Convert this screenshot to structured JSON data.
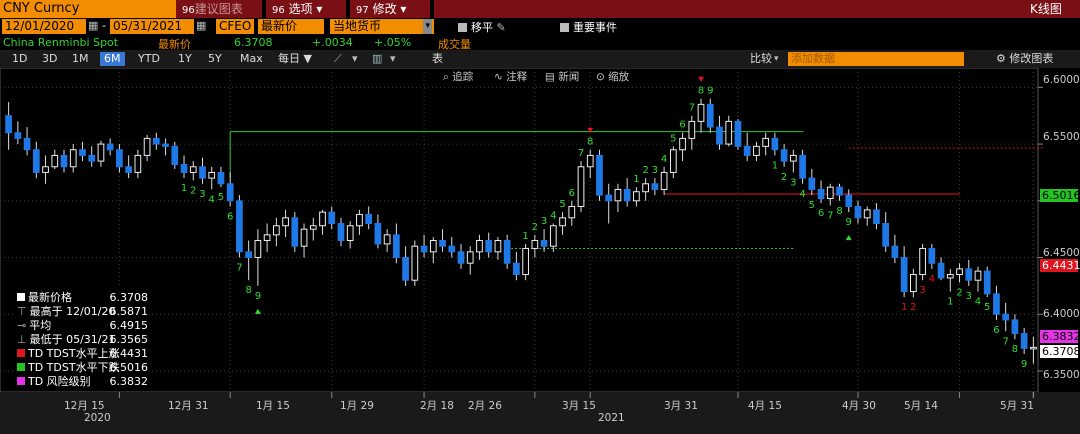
{
  "header": {
    "ticker": "CNY Curncy",
    "menus": [
      {
        "num": "96",
        "label": "建议图表"
      },
      {
        "num": "96",
        "label": "选项"
      },
      {
        "num": "97",
        "label": "修改"
      }
    ],
    "view_title": "K线图"
  },
  "controls": {
    "date_start": "12/01/2020",
    "date_end": "05/31/2021",
    "source": "CFEO",
    "field": "最新价",
    "currency": "当地货币",
    "move_label": "移平",
    "events_label": "重要事件"
  },
  "quote": {
    "name": "China Renminbi Spot",
    "last_label": "最新价",
    "last": "6.3708",
    "change": "+.0034",
    "pct": "+.05%",
    "volume_label": "成交量"
  },
  "toolbar": {
    "periods": [
      "1D",
      "3D",
      "1M",
      "6M",
      "YTD",
      "1Y",
      "5Y",
      "Max"
    ],
    "selected_period": "6M",
    "frequency": "每日",
    "table_label": "表",
    "compare_label": "比较",
    "compare_placeholder": "添加数据",
    "edit_label": "修改图表"
  },
  "chart_tools": {
    "track": "追踪",
    "annotate": "注释",
    "news": "新闻",
    "zoom": "缩放"
  },
  "legend": [
    {
      "label": "最新价格",
      "value": "6.3708",
      "color": "#ffffff"
    },
    {
      "label": "最高于 12/01/20",
      "value": "6.5871",
      "color": "none"
    },
    {
      "label": "平均",
      "value": "6.4915",
      "color": "none"
    },
    {
      "label": "最低于 05/31/21",
      "value": "6.3565",
      "color": "none"
    },
    {
      "label": "TD TDST水平上涨",
      "value": "6.4431",
      "color": "#e0141e"
    },
    {
      "label": "TD TDST水平下跌",
      "value": "6.5016",
      "color": "#22c322"
    },
    {
      "label": "TD 风险级别",
      "value": "6.3832",
      "color": "#e632e6"
    }
  ],
  "price_tags": [
    {
      "value": "6.5016",
      "bg": "#22c322",
      "fg": "#000000"
    },
    {
      "value": "6.4431",
      "bg": "#e0141e",
      "fg": "#ffffff"
    },
    {
      "value": "6.3832",
      "bg": "#e632e6",
      "fg": "#000000"
    },
    {
      "value": "6.3708",
      "bg": "#ffffff",
      "fg": "#000000"
    }
  ],
  "chart_data": {
    "type": "candlestick",
    "ylim": [
      6.335,
      6.61
    ],
    "yticks": [
      "6.6000",
      "6.5500",
      "6.5000",
      "6.4500",
      "6.4000",
      "6.3500"
    ],
    "xticks": [
      "12月 15",
      "12月 31",
      "1月 15",
      "1月 29",
      "2月 18",
      "2月 26",
      "3月 15",
      "3月 31",
      "4月 15",
      "4月 30",
      "5月 14",
      "5月 31"
    ],
    "year_labels": [
      "2020",
      "2021"
    ],
    "colors": {
      "up": "#ffffff",
      "down": "#1e78e6",
      "td_setup": "#32dc32",
      "td_countdown": "#e0141e"
    },
    "candles": [
      [
        6.575,
        6.587,
        6.545,
        6.56
      ],
      [
        6.56,
        6.57,
        6.55,
        6.555
      ],
      [
        6.555,
        6.565,
        6.54,
        6.545
      ],
      [
        6.545,
        6.552,
        6.52,
        6.525
      ],
      [
        6.525,
        6.54,
        6.515,
        6.53
      ],
      [
        6.53,
        6.545,
        6.528,
        6.54
      ],
      [
        6.54,
        6.545,
        6.525,
        6.53
      ],
      [
        6.53,
        6.55,
        6.525,
        6.545
      ],
      [
        6.545,
        6.552,
        6.535,
        6.54
      ],
      [
        6.54,
        6.548,
        6.53,
        6.535
      ],
      [
        6.535,
        6.553,
        6.53,
        6.55
      ],
      [
        6.55,
        6.555,
        6.54,
        6.545
      ],
      [
        6.545,
        6.55,
        6.525,
        6.53
      ],
      [
        6.53,
        6.54,
        6.52,
        6.525
      ],
      [
        6.525,
        6.545,
        6.52,
        6.54
      ],
      [
        6.54,
        6.558,
        6.535,
        6.555
      ],
      [
        6.555,
        6.56,
        6.545,
        6.55
      ],
      [
        6.55,
        6.555,
        6.54,
        6.548
      ],
      [
        6.548,
        6.552,
        6.528,
        6.532
      ],
      [
        6.532,
        6.54,
        6.52,
        6.525
      ],
      [
        6.525,
        6.535,
        6.518,
        6.53
      ],
      [
        6.53,
        6.538,
        6.515,
        6.52
      ],
      [
        6.52,
        6.53,
        6.51,
        6.525
      ],
      [
        6.525,
        6.53,
        6.512,
        6.515
      ],
      [
        6.515,
        6.525,
        6.495,
        6.5
      ],
      [
        6.5,
        6.505,
        6.45,
        6.455
      ],
      [
        6.455,
        6.465,
        6.43,
        6.45
      ],
      [
        6.45,
        6.475,
        6.425,
        6.465
      ],
      [
        6.465,
        6.48,
        6.455,
        6.47
      ],
      [
        6.47,
        6.485,
        6.46,
        6.478
      ],
      [
        6.478,
        6.492,
        6.468,
        6.485
      ],
      [
        6.485,
        6.49,
        6.455,
        6.46
      ],
      [
        6.46,
        6.48,
        6.45,
        6.475
      ],
      [
        6.475,
        6.485,
        6.465,
        6.478
      ],
      [
        6.478,
        6.492,
        6.47,
        6.49
      ],
      [
        6.49,
        6.495,
        6.475,
        6.48
      ],
      [
        6.48,
        6.485,
        6.46,
        6.465
      ],
      [
        6.465,
        6.482,
        6.458,
        6.478
      ],
      [
        6.478,
        6.492,
        6.47,
        6.488
      ],
      [
        6.488,
        6.495,
        6.475,
        6.48
      ],
      [
        6.48,
        6.488,
        6.458,
        6.462
      ],
      [
        6.462,
        6.475,
        6.455,
        6.47
      ],
      [
        6.47,
        6.48,
        6.445,
        6.45
      ],
      [
        6.45,
        6.46,
        6.425,
        6.43
      ],
      [
        6.43,
        6.465,
        6.425,
        6.46
      ],
      [
        6.46,
        6.47,
        6.45,
        6.455
      ],
      [
        6.455,
        6.468,
        6.445,
        6.465
      ],
      [
        6.465,
        6.475,
        6.455,
        6.46
      ],
      [
        6.46,
        6.468,
        6.45,
        6.455
      ],
      [
        6.455,
        6.462,
        6.44,
        6.445
      ],
      [
        6.445,
        6.46,
        6.435,
        6.455
      ],
      [
        6.455,
        6.47,
        6.448,
        6.465
      ],
      [
        6.465,
        6.472,
        6.45,
        6.455
      ],
      [
        6.455,
        6.468,
        6.448,
        6.465
      ],
      [
        6.465,
        6.47,
        6.44,
        6.445
      ],
      [
        6.445,
        6.455,
        6.43,
        6.435
      ],
      [
        6.435,
        6.462,
        6.43,
        6.458
      ],
      [
        6.458,
        6.47,
        6.45,
        6.465
      ],
      [
        6.465,
        6.475,
        6.455,
        6.46
      ],
      [
        6.46,
        6.48,
        6.455,
        6.478
      ],
      [
        6.478,
        6.49,
        6.47,
        6.485
      ],
      [
        6.485,
        6.5,
        6.478,
        6.495
      ],
      [
        6.495,
        6.535,
        6.49,
        6.53
      ],
      [
        6.53,
        6.545,
        6.52,
        6.54
      ],
      [
        6.54,
        6.545,
        6.5,
        6.505
      ],
      [
        6.505,
        6.515,
        6.48,
        6.5
      ],
      [
        6.5,
        6.515,
        6.49,
        6.51
      ],
      [
        6.51,
        6.52,
        6.495,
        6.5
      ],
      [
        6.5,
        6.512,
        6.495,
        6.508
      ],
      [
        6.508,
        6.52,
        6.5,
        6.515
      ],
      [
        6.515,
        6.52,
        6.505,
        6.51
      ],
      [
        6.51,
        6.53,
        6.505,
        6.525
      ],
      [
        6.525,
        6.548,
        6.52,
        6.545
      ],
      [
        6.545,
        6.56,
        6.535,
        6.555
      ],
      [
        6.555,
        6.575,
        6.545,
        6.57
      ],
      [
        6.57,
        6.59,
        6.56,
        6.585
      ],
      [
        6.585,
        6.59,
        6.56,
        6.565
      ],
      [
        6.565,
        6.575,
        6.545,
        6.55
      ],
      [
        6.55,
        6.575,
        6.548,
        6.57
      ],
      [
        6.57,
        6.572,
        6.545,
        6.548
      ],
      [
        6.548,
        6.56,
        6.535,
        6.54
      ],
      [
        6.54,
        6.552,
        6.535,
        6.548
      ],
      [
        6.548,
        6.56,
        6.54,
        6.555
      ],
      [
        6.555,
        6.56,
        6.54,
        6.545
      ],
      [
        6.545,
        6.55,
        6.53,
        6.535
      ],
      [
        6.535,
        6.545,
        6.525,
        6.54
      ],
      [
        6.54,
        6.545,
        6.515,
        6.52
      ],
      [
        6.52,
        6.528,
        6.505,
        6.51
      ],
      [
        6.51,
        6.518,
        6.498,
        6.502
      ],
      [
        6.502,
        6.515,
        6.496,
        6.512
      ],
      [
        6.512,
        6.515,
        6.5,
        6.505
      ],
      [
        6.505,
        6.51,
        6.49,
        6.495
      ],
      [
        6.495,
        6.5,
        6.48,
        6.485
      ],
      [
        6.485,
        6.495,
        6.478,
        6.492
      ],
      [
        6.492,
        6.498,
        6.475,
        6.48
      ],
      [
        6.48,
        6.49,
        6.455,
        6.46
      ],
      [
        6.46,
        6.47,
        6.445,
        6.45
      ],
      [
        6.45,
        6.46,
        6.415,
        6.42
      ],
      [
        6.42,
        6.44,
        6.415,
        6.435
      ],
      [
        6.435,
        6.462,
        6.43,
        6.458
      ],
      [
        6.458,
        6.462,
        6.44,
        6.445
      ],
      [
        6.445,
        6.45,
        6.43,
        6.432
      ],
      [
        6.432,
        6.44,
        6.42,
        6.435
      ],
      [
        6.435,
        6.445,
        6.428,
        6.44
      ],
      [
        6.44,
        6.448,
        6.425,
        6.43
      ],
      [
        6.43,
        6.442,
        6.42,
        6.438
      ],
      [
        6.438,
        6.442,
        6.415,
        6.418
      ],
      [
        6.418,
        6.425,
        6.395,
        6.4
      ],
      [
        6.4,
        6.41,
        6.385,
        6.395
      ],
      [
        6.395,
        6.4,
        6.378,
        6.383
      ],
      [
        6.383,
        6.388,
        6.365,
        6.37
      ],
      [
        6.37,
        6.38,
        6.3565,
        6.3708
      ]
    ],
    "resistance_green": {
      "value": 6.561,
      "from": 24,
      "to": 85
    },
    "support_green": {
      "value": 6.458,
      "from": 54,
      "to": 84
    },
    "tdst_red_1": {
      "value": 6.506,
      "from": 71,
      "to": 102
    },
    "tdst_red_2": {
      "value": 6.5465,
      "from": 91,
      "to": 128
    },
    "tdst_red_3": {
      "value": 6.4431,
      "from": 112,
      "to": 128
    }
  }
}
